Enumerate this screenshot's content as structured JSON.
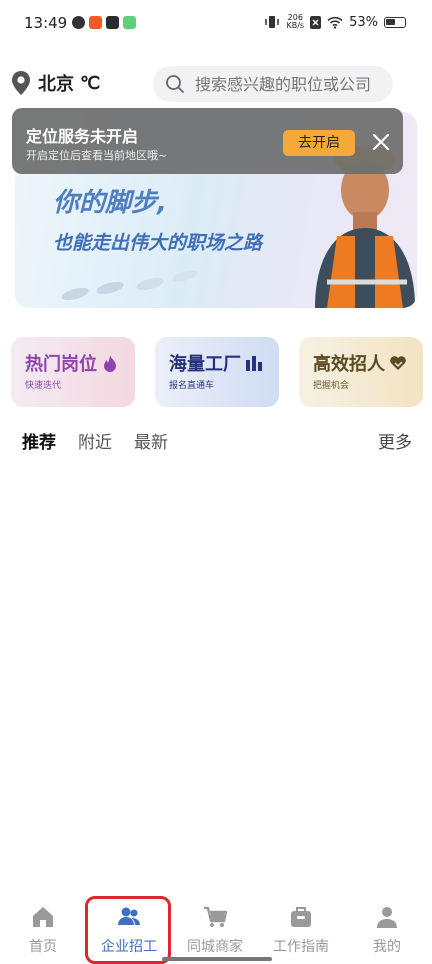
{
  "status_bar": {
    "time": "13:49",
    "net_speed_value": "206",
    "net_speed_unit": "KB/s",
    "battery": "53%"
  },
  "header": {
    "location": "北京",
    "temperature": "℃",
    "search_placeholder": "搜索感兴趣的职位或公司"
  },
  "banner": {
    "line1": "你的脚步,",
    "line2": "也能走出伟大的职场之路"
  },
  "toast": {
    "title": "定位服务未开启",
    "subtitle": "开启定位后查看当前地区哦~",
    "button": "去开启"
  },
  "cards": [
    {
      "title": "热门岗位",
      "subtitle": "快速迭代",
      "icon": "flame-icon"
    },
    {
      "title": "海量工厂",
      "subtitle": "报名直通车",
      "icon": "factory-icon"
    },
    {
      "title": "高效招人",
      "subtitle": "把握机会",
      "icon": "handshake-heart-icon"
    }
  ],
  "tabs": {
    "items": [
      "推荐",
      "附近",
      "最新"
    ],
    "active": "推荐",
    "more": "更多"
  },
  "bottom_nav": {
    "items": [
      {
        "label": "首页",
        "icon": "home-icon"
      },
      {
        "label": "企业招工",
        "icon": "people-icon"
      },
      {
        "label": "同城商家",
        "icon": "cart-icon"
      },
      {
        "label": "工作指南",
        "icon": "briefcase-icon"
      },
      {
        "label": "我的",
        "icon": "person-icon"
      }
    ],
    "active": "企业招工"
  },
  "colors": {
    "accent": "#3d6fc4",
    "toast_button": "#f6a93b",
    "highlight": "#e0262b"
  }
}
